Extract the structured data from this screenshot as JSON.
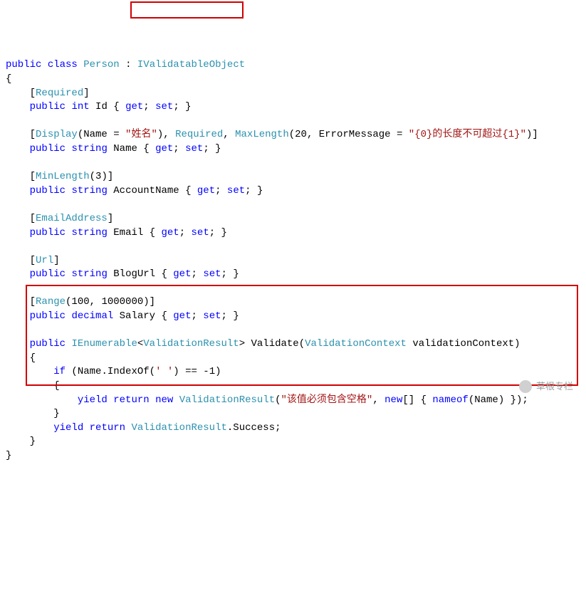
{
  "code": {
    "l01": {
      "t1": "public",
      "t2": "class",
      "t3": "Person",
      "t4": " : ",
      "t5": "IValidatableObject"
    },
    "l02": "{",
    "l03": {
      "t1": "    [",
      "t2": "Required",
      "t3": "]"
    },
    "l04": {
      "t1": "    ",
      "t2": "public",
      "t3": "int",
      "t4": " Id { ",
      "t5": "get",
      "t6": "; ",
      "t7": "set",
      "t8": "; }"
    },
    "l05": "",
    "l06": {
      "t1": "    [",
      "t2": "Display",
      "t3": "(Name = ",
      "t4": "\"姓名\"",
      "t5": "), ",
      "t6": "Required",
      "t7": ", ",
      "t8": "MaxLength",
      "t9": "(20, ErrorMessage = ",
      "t10": "\"{0}的长度不可超过{1}\"",
      "t11": ")]"
    },
    "l07": {
      "t1": "    ",
      "t2": "public",
      "t3": "string",
      "t4": " Name { ",
      "t5": "get",
      "t6": "; ",
      "t7": "set",
      "t8": "; }"
    },
    "l08": "",
    "l09": {
      "t1": "    [",
      "t2": "MinLength",
      "t3": "(3)]"
    },
    "l10": {
      "t1": "    ",
      "t2": "public",
      "t3": "string",
      "t4": " AccountName { ",
      "t5": "get",
      "t6": "; ",
      "t7": "set",
      "t8": "; }"
    },
    "l11": "",
    "l12": {
      "t1": "    [",
      "t2": "EmailAddress",
      "t3": "]"
    },
    "l13": {
      "t1": "    ",
      "t2": "public",
      "t3": "string",
      "t4": " Email { ",
      "t5": "get",
      "t6": "; ",
      "t7": "set",
      "t8": "; }"
    },
    "l14": "",
    "l15": {
      "t1": "    [",
      "t2": "Url",
      "t3": "]"
    },
    "l16": {
      "t1": "    ",
      "t2": "public",
      "t3": "string",
      "t4": " BlogUrl { ",
      "t5": "get",
      "t6": "; ",
      "t7": "set",
      "t8": "; }"
    },
    "l17": "",
    "l18": {
      "t1": "    [",
      "t2": "Range",
      "t3": "(100, 1000000)]"
    },
    "l19": {
      "t1": "    ",
      "t2": "public",
      "t3": "decimal",
      "t4": " Salary { ",
      "t5": "get",
      "t6": "; ",
      "t7": "set",
      "t8": "; }"
    },
    "l20": "",
    "l21": {
      "t1": "    ",
      "t2": "public",
      "t3": "IEnumerable",
      "t4": "<",
      "t5": "ValidationResult",
      "t6": "> Validate(",
      "t7": "ValidationContext",
      "t8": " validationContext)"
    },
    "l22": "    {",
    "l23": {
      "t1": "        ",
      "t2": "if",
      "t3": " (Name.IndexOf(",
      "t4": "' '",
      "t5": ") == -1)"
    },
    "l24": "        {",
    "l25": {
      "t1": "            ",
      "t2": "yield",
      "t3": "return",
      "t4": "new",
      "t5": "ValidationResult",
      "t6": "(",
      "t7": "\"该值必须包含空格\"",
      "t8": ", ",
      "t9": "new",
      "t10": "[] { ",
      "t11": "nameof",
      "t12": "(Name) });"
    },
    "l26": "        }",
    "l27": {
      "t1": "        ",
      "t2": "yield",
      "t3": "return",
      "t4": "ValidationResult",
      "t5": ".Success;"
    },
    "l28": "    }",
    "l29": "}"
  },
  "watermark": "草根专栏"
}
